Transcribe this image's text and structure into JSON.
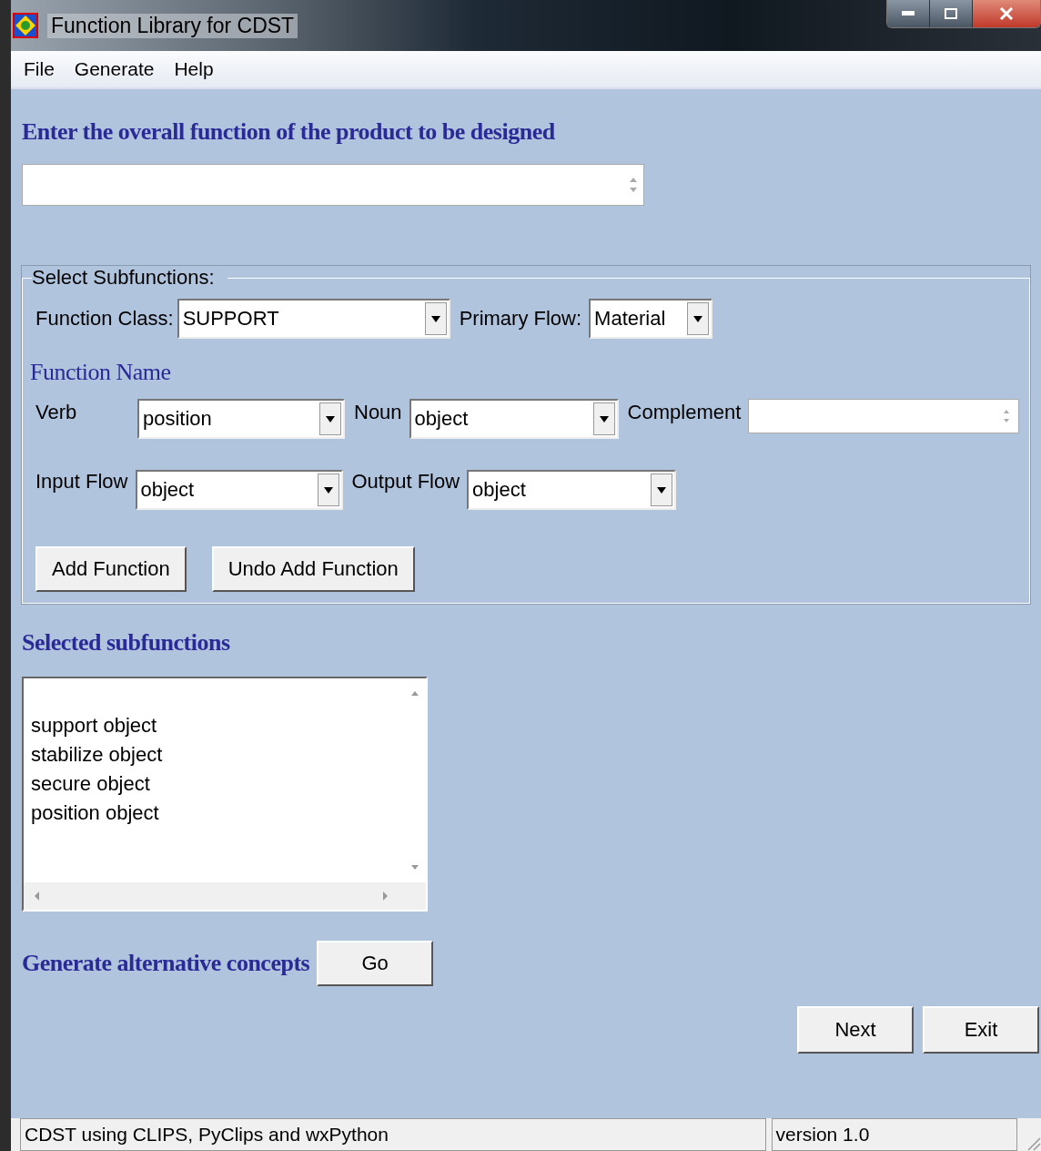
{
  "window": {
    "title": "Function Library for CDST"
  },
  "menu": [
    "File",
    "Generate",
    "Help"
  ],
  "overall_function": {
    "heading": "Enter the overall function of the product to be designed"
  },
  "subfunctions_group": {
    "title": "Select Subfunctions:",
    "function_class": {
      "label": "Function Class:",
      "value": "SUPPORT"
    },
    "primary_flow": {
      "label": "Primary Flow:",
      "value": "Material"
    },
    "function_name_heading": "Function Name",
    "verb": {
      "label": "Verb",
      "value": "position"
    },
    "noun": {
      "label": "Noun",
      "value": "object"
    },
    "complement": {
      "label": "Complement"
    },
    "input_flow": {
      "label": "Input Flow",
      "value": "object"
    },
    "output_flow": {
      "label": "Output Flow",
      "value": "object"
    },
    "buttons": [
      "Add Function",
      "Undo Add Function"
    ]
  },
  "selected_subfunctions": {
    "heading": "Selected subfunctions",
    "items": [
      "support object",
      "stabilize object",
      "secure object",
      "position object"
    ]
  },
  "generate": {
    "label": "Generate alternative concepts",
    "button": "Go"
  },
  "nav_buttons": [
    "Next",
    "Exit"
  ],
  "status_bar": [
    "CDST using CLIPS, PyClips and wxPython",
    "version 1.0"
  ]
}
